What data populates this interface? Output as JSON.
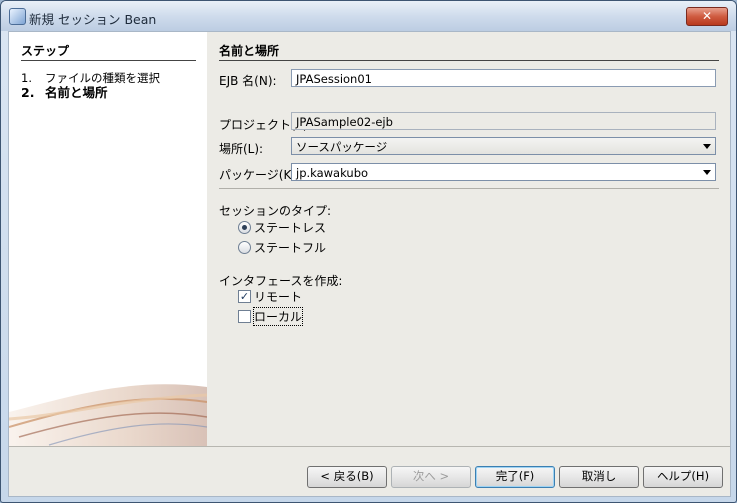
{
  "window": {
    "title": "新規 セッション Bean",
    "close_glyph": "✕"
  },
  "steps": {
    "heading": "ステップ",
    "items": [
      {
        "num": "1.",
        "label": "ファイルの種類を選択"
      },
      {
        "num": "2.",
        "label": "名前と場所"
      }
    ]
  },
  "form": {
    "section_title": "名前と場所",
    "ejb_name_label": "EJB 名(N):",
    "ejb_name_value": "JPASession01",
    "project_label": "プロジェクト(P):",
    "project_value": "JPASample02-ejb",
    "location_label": "場所(L):",
    "location_value": "ソースパッケージ",
    "package_label": "パッケージ(K):",
    "package_value": "jp.kawakubo",
    "session_type_label": "セッションのタイプ:",
    "stateless_label": "ステートレス",
    "stateful_label": "ステートフル",
    "interface_label": "インタフェースを作成:",
    "remote_label": "リモート",
    "local_label": "ローカル",
    "selected_session_type": "ステートレス",
    "remote_checked": true,
    "local_checked": false
  },
  "buttons": {
    "back": "< 戻る(B)",
    "next": "次へ >",
    "finish": "完了(F)",
    "cancel": "取消し",
    "help": "ヘルプ(H)"
  },
  "colors": {
    "title_gradient_top": "#e9f0f8",
    "close_button": "#cf5b40",
    "panel_bg": "#ecebe6",
    "default_button_border": "#3c7fb1"
  }
}
